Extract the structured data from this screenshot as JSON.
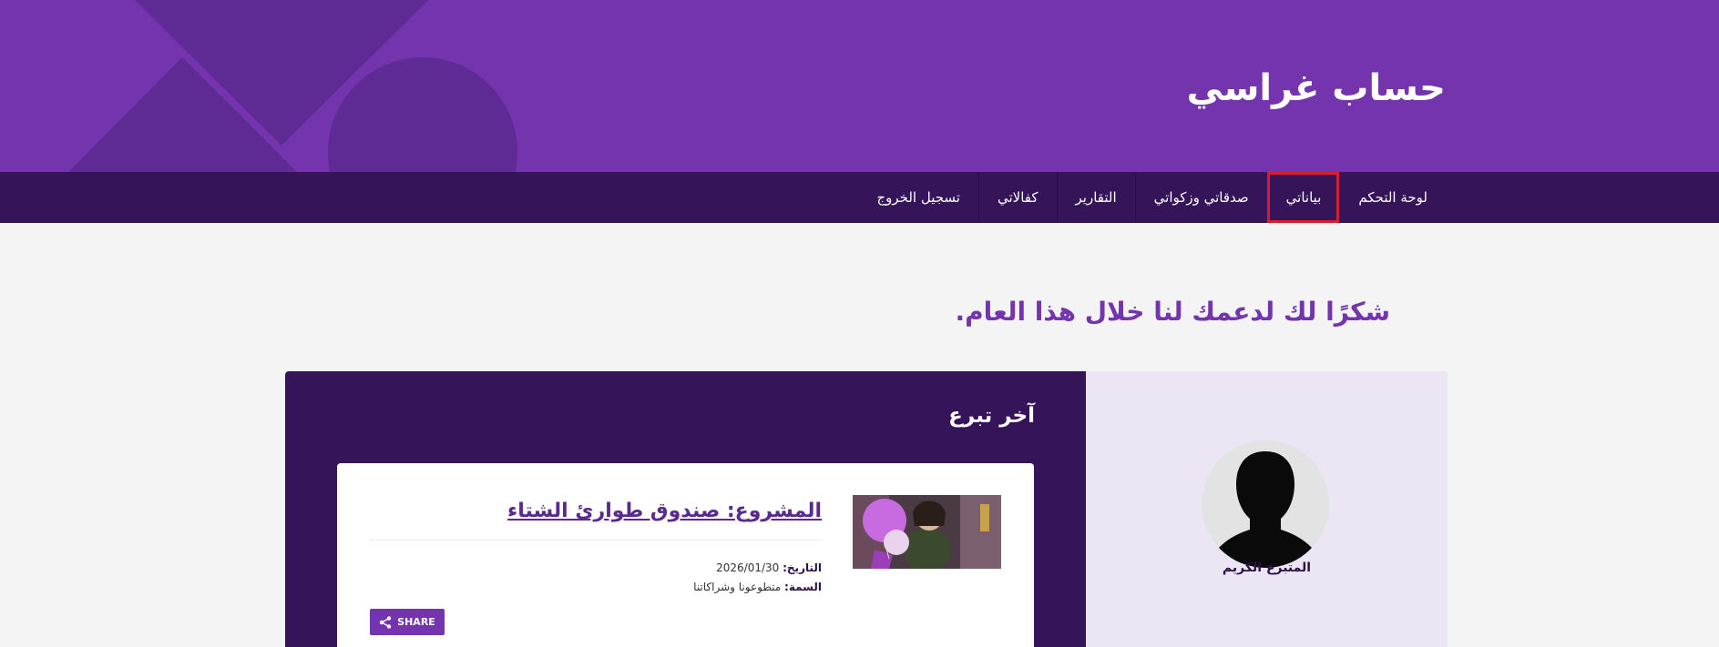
{
  "header": {
    "title": "حساب غراسي",
    "background_color": "#7434ad"
  },
  "nav": {
    "items": [
      {
        "label": "لوحة التحكم",
        "active": false
      },
      {
        "label": "بياناتي",
        "active": true
      },
      {
        "label": "صدقاتي وزكواتي",
        "active": false
      },
      {
        "label": "التقارير",
        "active": false
      },
      {
        "label": "كفالاتي",
        "active": false
      },
      {
        "label": "تسجيل الخروج",
        "active": false
      }
    ],
    "background_color": "#36145a",
    "highlight_color": "#d81e2b"
  },
  "main": {
    "thanks_message": "شكرًا لك لدعمك لنا خلال هذا العام."
  },
  "profile": {
    "name": "المتبرع الكريم",
    "avatar_icon": "person-silhouette-icon"
  },
  "latest_donation": {
    "heading": "آخر تبرع",
    "project_title": "المشروع: صندوق طوارئ الشتاء",
    "date_label": "التاريخ:",
    "date_value": "2026/01/30",
    "tag_label": "السمة:",
    "tag_value": "متطوعونا وشراكاتنا",
    "share_label": "SHARE",
    "share_icon": "share-icon"
  },
  "colors": {
    "accent": "#7434ad",
    "dark_purple": "#36145a",
    "light_lavender": "#ebe5f4"
  }
}
